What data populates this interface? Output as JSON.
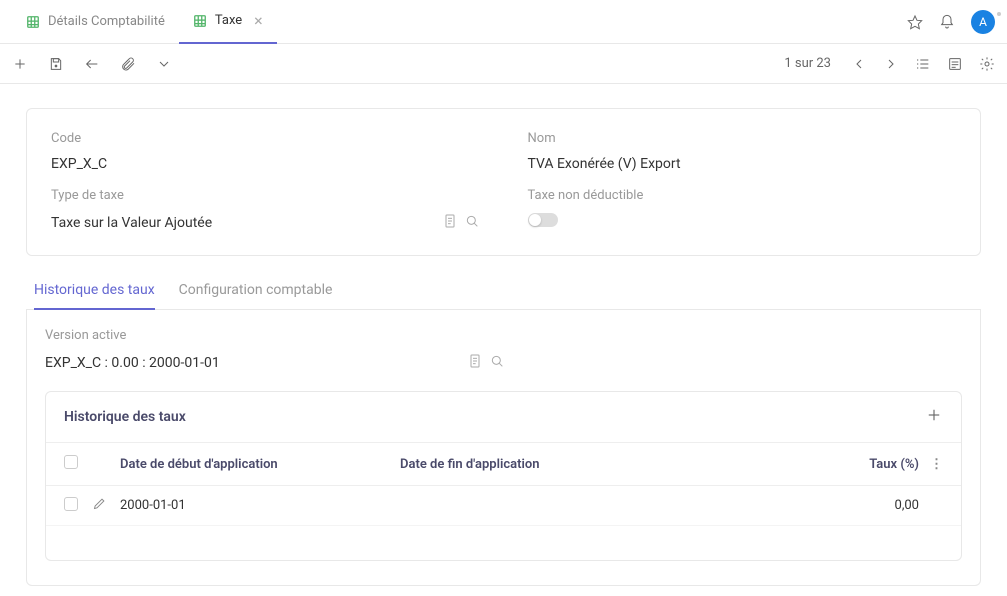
{
  "tabs": [
    {
      "label": "Détails Comptabilité",
      "active": false
    },
    {
      "label": "Taxe",
      "active": true
    }
  ],
  "avatar": "A",
  "pager": {
    "text": "1 sur 23"
  },
  "form": {
    "code_label": "Code",
    "code_value": "EXP_X_C",
    "name_label": "Nom",
    "name_value": "TVA Exonérée (V) Export",
    "taxtype_label": "Type de taxe",
    "taxtype_value": "Taxe sur la Valeur Ajoutée",
    "nondeductible_label": "Taxe non déductible"
  },
  "subtabs": {
    "history": "Historique des taux",
    "config": "Configuration comptable"
  },
  "version": {
    "label": "Version active",
    "value": "EXP_X_C : 0.00 : 2000-01-01"
  },
  "grid": {
    "title": "Historique des taux",
    "cols": {
      "start": "Date de début d'application",
      "end": "Date de fin d'application",
      "rate": "Taux (%)"
    },
    "rows": [
      {
        "start": "2000-01-01",
        "end": "",
        "rate": "0,00"
      }
    ]
  }
}
